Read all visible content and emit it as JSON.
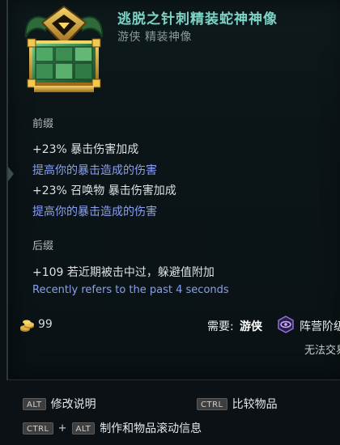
{
  "item": {
    "title": "逃脱之针刺精装蛇神神像",
    "subtitle": "游侠 精装神像"
  },
  "prefix": {
    "label": "前缀",
    "mods": [
      {
        "value": "+23% 暴击伤害加成",
        "desc": "提高你的暴击造成的伤害"
      },
      {
        "value": "+23% 召唤物 暴击伤害加成",
        "desc": "提高你的暴击造成的伤害"
      }
    ]
  },
  "suffix": {
    "label": "后缀",
    "mod": "+109 若近期被击中过，躲避值附加",
    "note": "Recently refers to the past 4 seconds"
  },
  "footer": {
    "price": "99",
    "requires_label": "需要:",
    "requires_class": "游侠",
    "faction_text": "阵营阶级",
    "untradeable": "无法交易"
  },
  "hints": {
    "alt_key": "ALT",
    "alt_label": "修改说明",
    "ctrl_key": "CTRL",
    "ctrl_label": "比较物品",
    "combo_ctrl": "CTRL",
    "combo_plus": "+",
    "combo_alt": "ALT",
    "combo_label": "制作和物品滚动信息"
  },
  "icons": {
    "item": "idol-icon",
    "coin": "gold-coin-icon",
    "faction": "faction-eye-icon"
  },
  "colors": {
    "title": "#7ed3c4",
    "desc": "#8aa0f0",
    "background": "#0b1114"
  }
}
